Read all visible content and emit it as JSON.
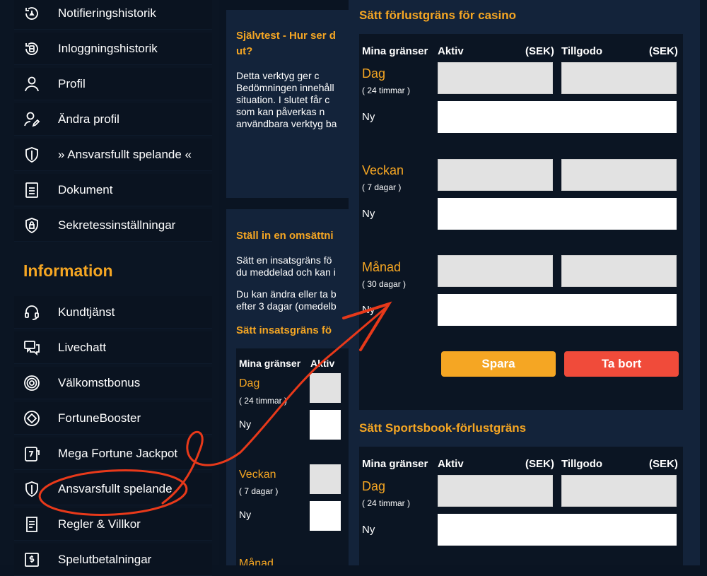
{
  "nav_top": [
    {
      "label": "Notifieringshistorik",
      "icon": "notification-history-icon"
    },
    {
      "label": "Inloggningshistorik",
      "icon": "login-history-icon"
    },
    {
      "label": "Profil",
      "icon": "user-icon"
    },
    {
      "label": "Ändra profil",
      "icon": "edit-user-icon"
    },
    {
      "label": "» Ansvarsfullt spelande «",
      "icon": "shield-icon"
    },
    {
      "label": "Dokument",
      "icon": "document-icon"
    },
    {
      "label": "Sekretessinställningar",
      "icon": "shield-lock-icon"
    }
  ],
  "info_heading": "Information",
  "nav_info": [
    {
      "label": "Kundtjänst",
      "icon": "headset-icon"
    },
    {
      "label": "Livechatt",
      "icon": "chat-icon"
    },
    {
      "label": "Välkomstbonus",
      "icon": "target-icon"
    },
    {
      "label": "FortuneBooster",
      "icon": "diamond-icon"
    },
    {
      "label": "Mega Fortune Jackpot",
      "icon": "slot-machine-icon"
    },
    {
      "label": "Ansvarsfullt spelande",
      "icon": "shield-icon"
    },
    {
      "label": "Regler & Villkor",
      "icon": "rules-icon"
    },
    {
      "label": "Spelutbetalningar",
      "icon": "payout-icon"
    }
  ],
  "middle": {
    "selftest_title": "Självtest - Hur ser d ut?",
    "selftest_lines": [
      "Detta verktyg ger c",
      "Bedömningen innehåll",
      "situation. I slutet får c",
      "som kan påverkas n",
      "användbara verktyg ba"
    ],
    "turnover_title": "Ställ in en omsättni",
    "turnover_lines1": [
      "Sätt en insatsgräns fö",
      "du meddelad och kan i"
    ],
    "turnover_lines2": [
      "Du kan ändra eller ta b",
      "efter 3 dagar (omedelb"
    ],
    "stake_title": "Sätt insatsgräns fö",
    "my_limits": "Mina gränser",
    "active": "Aktiv",
    "day": "Dag",
    "day_sub": "( 24 timmar )",
    "new": "Ny",
    "week": "Veckan",
    "week_sub": "( 7 dagar )",
    "month_partial": "Månad"
  },
  "casino": {
    "title": "Sätt förlustgräns för casino",
    "col_limits": "Mina gränser",
    "col_active": "Aktiv",
    "col_sek1": "(SEK)",
    "col_balance": "Tillgodo",
    "col_sek2": "(SEK)",
    "day": "Dag",
    "day_sub": "( 24 timmar )",
    "week": "Veckan",
    "week_sub": "( 7 dagar )",
    "month": "Månad",
    "month_sub": "( 30 dagar )",
    "new": "Ny",
    "save": "Spara",
    "delete": "Ta bort"
  },
  "sportsbook": {
    "title": "Sätt Sportsbook-förlustgräns",
    "col_limits": "Mina gränser",
    "col_active": "Aktiv",
    "col_sek1": "(SEK)",
    "col_balance": "Tillgodo",
    "col_sek2": "(SEK)",
    "day": "Dag",
    "day_sub": "( 24 timmar )",
    "new": "Ny"
  },
  "colors": {
    "accent": "#f5a623",
    "danger": "#f04b3a",
    "annotation": "#e8391a",
    "panel": "#13233a",
    "bg": "#0b1523"
  }
}
